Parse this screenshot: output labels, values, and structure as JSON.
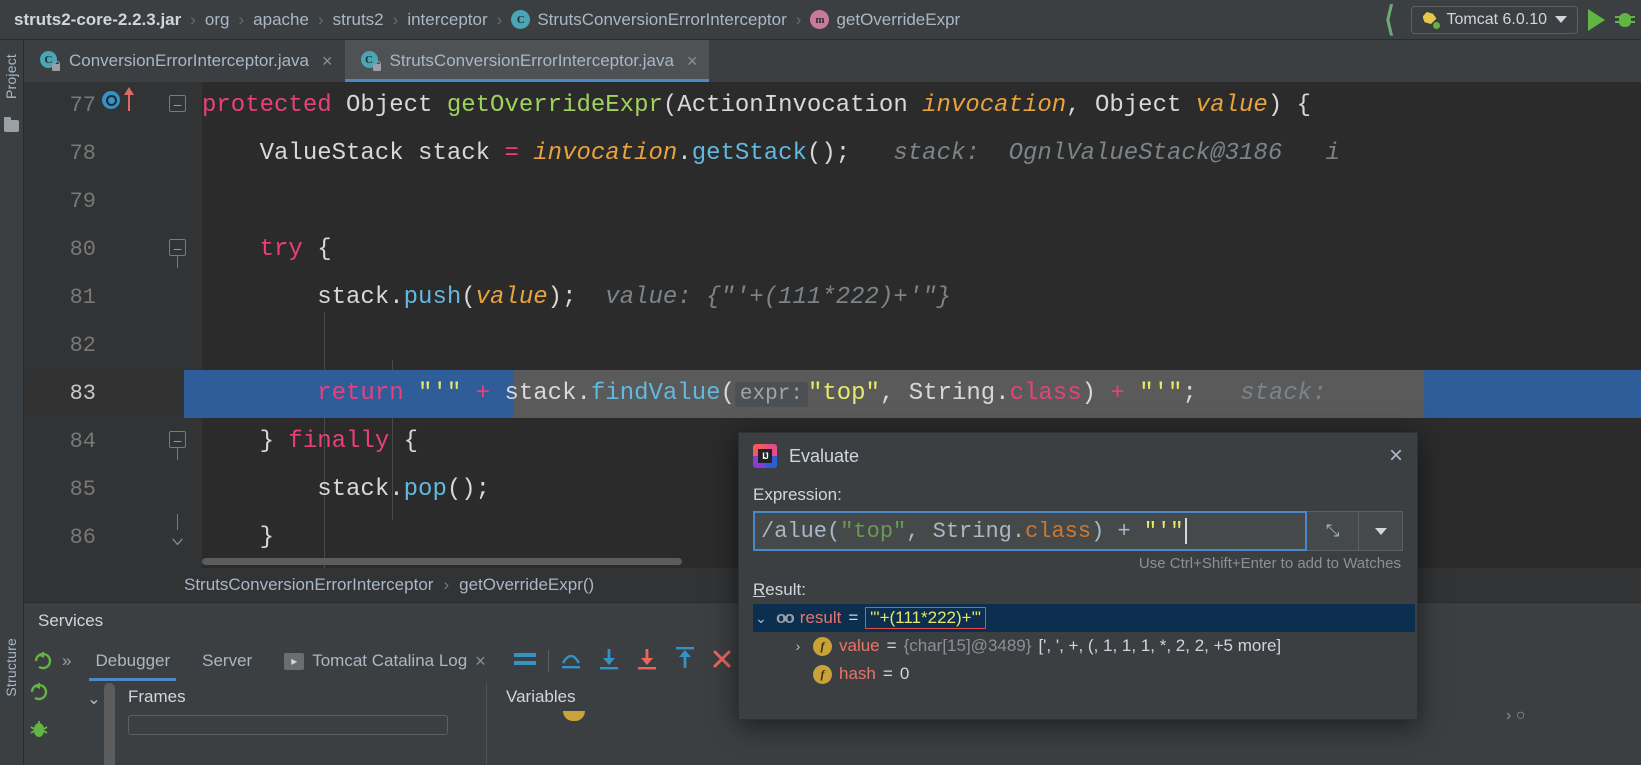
{
  "topbar": {
    "breadcrumbs": [
      {
        "label": "struts2-core-2.2.3.jar",
        "icon": "",
        "bold": true
      },
      {
        "label": "org",
        "icon": ""
      },
      {
        "label": "apache",
        "icon": ""
      },
      {
        "label": "struts2",
        "icon": ""
      },
      {
        "label": "interceptor",
        "icon": ""
      },
      {
        "label": "StrutsConversionErrorInterceptor",
        "icon": "C"
      },
      {
        "label": "getOverrideExpr",
        "icon": "m"
      }
    ],
    "separator": "›",
    "run_config": "Tomcat 6.0.10",
    "accent_green": "#62b543",
    "accent_blue": "#4a88c7"
  },
  "left_strip": {
    "project_label": "Project",
    "structure_label": "Structure"
  },
  "tabs": [
    {
      "label": "ConversionErrorInterceptor.java",
      "icon": "C",
      "active": false,
      "close": "×"
    },
    {
      "label": "StrutsConversionErrorInterceptor.java",
      "icon": "C",
      "active": true,
      "close": "×"
    }
  ],
  "editor": {
    "lines": [
      {
        "num": "77",
        "breakpoint": true,
        "fold": "open",
        "current": false
      },
      {
        "num": "78",
        "breakpoint": false,
        "fold": "none",
        "current": false
      },
      {
        "num": "79",
        "breakpoint": false,
        "fold": "none",
        "current": false
      },
      {
        "num": "80",
        "breakpoint": false,
        "fold": "open",
        "current": false
      },
      {
        "num": "81",
        "breakpoint": false,
        "fold": "none",
        "current": false
      },
      {
        "num": "82",
        "breakpoint": false,
        "fold": "none",
        "current": false
      },
      {
        "num": "83",
        "breakpoint": false,
        "fold": "none",
        "current": true
      },
      {
        "num": "84",
        "breakpoint": false,
        "fold": "open",
        "current": false
      },
      {
        "num": "85",
        "breakpoint": false,
        "fold": "none",
        "current": false
      },
      {
        "num": "86",
        "breakpoint": false,
        "fold": "close",
        "current": false
      }
    ],
    "code": {
      "l77_kw": "protected",
      "l77_type": " Object ",
      "l77_method": "getOverrideExpr",
      "l77_open": "(ActionInvocation ",
      "l77_p1": "invocation",
      "l77_mid": ", Object ",
      "l77_p2": "value",
      "l77_end": ") {",
      "l78_type": "    ValueStack stack ",
      "l78_eq": "=",
      "l78_var": " invocation",
      "l78_dot": ".",
      "l78_call": "getStack",
      "l78_tail": "();",
      "l78_hint": "stack:  OgnlValueStack@3186",
      "l78_hint2": "i",
      "l80_try": "    try",
      "l80_brace": " {",
      "l81_obj": "        stack",
      "l81_dot": ".",
      "l81_call": "push",
      "l81_open": "(",
      "l81_arg": "value",
      "l81_close": ");",
      "l81_hint": "value: {\"'+(111*222)+'\"}",
      "l83_ret": "return",
      "l83_s1": " \"'\"",
      "l83_plus1": " + ",
      "l83_obj": "stack",
      "l83_dot": ".",
      "l83_call": "findValue",
      "l83_paren": "(",
      "l83_phint": "expr:",
      "l83_arg1": "\"top\"",
      "l83_comma": ", String.",
      "l83_cls": "class",
      "l83_close": ")",
      "l83_plus2": " + ",
      "l83_s2": "\"'\"",
      "l83_semi": ";",
      "l83_hint": "stack:",
      "l84_brace": "    } ",
      "l84_kw": "finally",
      "l84_open": " {",
      "l85_obj": "        stack",
      "l85_dot": ".",
      "l85_call": "pop",
      "l85_tail": "();",
      "l86_close": "    }"
    }
  },
  "editor_breadcrumb": {
    "class": "StrutsConversionErrorInterceptor",
    "separator": "›",
    "method": "getOverrideExpr()"
  },
  "services": {
    "title": "Services",
    "overflow": "»",
    "tabs": [
      {
        "label": "Debugger",
        "active": true
      },
      {
        "label": "Server",
        "active": false
      },
      {
        "label": "Tomcat Catalina Log",
        "active": false,
        "has_icon": true,
        "close": "×"
      }
    ],
    "panes": {
      "frames": "Frames",
      "variables": "Variables"
    }
  },
  "evaluate": {
    "title": "Evaluate",
    "close": "×",
    "expression_label": "Expression:",
    "expression_value": "/alue(\"top\", String.class) + \"'\"",
    "expr_seg_prefix": "/alue(",
    "expr_seg_str": "\"top\"",
    "expr_seg_mid": ", String.",
    "expr_seg_cls": "class",
    "expr_seg_tail": ") + ",
    "expr_seg_str2": "\"'\"",
    "expand_icon": "⤡",
    "dropdown_icon": "▼",
    "watch_hint": "Use Ctrl+Shift+Enter to add to Watches",
    "result_label": "Result:",
    "result_label_mnemonic": "R",
    "result_label_rest": "esult:",
    "tree": [
      {
        "indent": 0,
        "twisty": "⌄",
        "icon": "oo",
        "name": "result",
        "eq": "=",
        "value": "\"'+(111*222)+'\"",
        "highlighted": true,
        "selected": true
      },
      {
        "indent": 1,
        "twisty": "›",
        "icon": "f",
        "name": "value",
        "eq": "=",
        "type": "{char[15]@3489}",
        "value": "[', ', +, (, 1, 1, 1, *, 2, 2, +5 more]",
        "highlighted": false,
        "selected": false
      },
      {
        "indent": 1,
        "twisty": "",
        "icon": "f",
        "name": "hash",
        "eq": "=",
        "value": "0",
        "highlighted": false,
        "selected": false
      }
    ]
  },
  "colors": {
    "bg_editor": "#2b2b2b",
    "bg_panel": "#3c3f41",
    "gutter": "#313335",
    "selection_blue": "#2f5d99",
    "exec_line": "#5a5a5a",
    "tree_selection": "#0d2f4f",
    "red_highlight": "#e04d4d",
    "string_yellow": "#e8e86a",
    "keyword_orange": "#cc7832"
  }
}
